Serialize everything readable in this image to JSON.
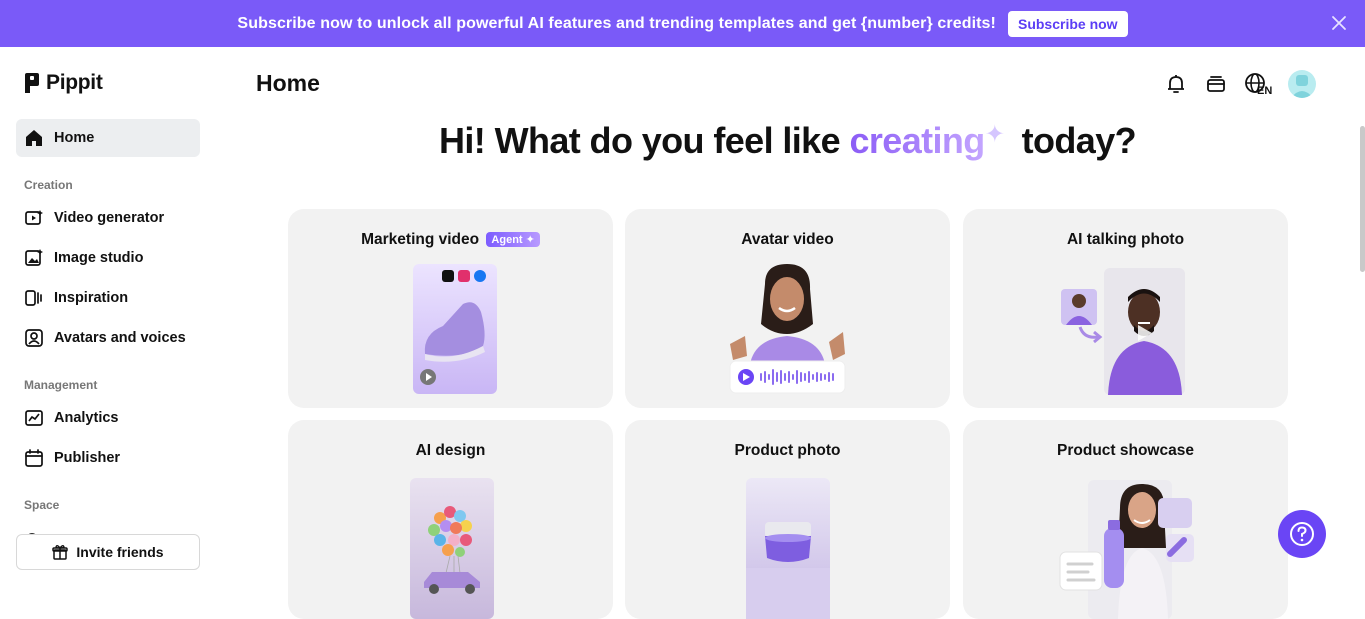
{
  "banner": {
    "text": "Subscribe now to unlock all powerful AI features and trending templates and get {number} credits!",
    "button_label": "Subscribe now"
  },
  "brand": {
    "name": "Pippit"
  },
  "sidebar": {
    "home": "Home",
    "sections": [
      {
        "label": "Creation"
      },
      {
        "label": "Management"
      },
      {
        "label": "Space"
      }
    ],
    "creation_items": [
      "Video generator",
      "Image studio",
      "Inspiration",
      "Avatars and voices"
    ],
    "management_items": [
      "Analytics",
      "Publisher"
    ],
    "invite_label": "Invite friends"
  },
  "header": {
    "title": "Home",
    "language": "EN"
  },
  "hero": {
    "prefix": "Hi! What do you feel like ",
    "accent": "creating",
    "suffix": " today?"
  },
  "cards": [
    {
      "title": "Marketing video",
      "badge": "Agent"
    },
    {
      "title": "Avatar video"
    },
    {
      "title": "AI talking photo"
    },
    {
      "title": "AI design"
    },
    {
      "title": "Product photo"
    },
    {
      "title": "Product showcase"
    }
  ],
  "colors": {
    "brand": "#7a5af8",
    "help": "#6a45f5"
  }
}
